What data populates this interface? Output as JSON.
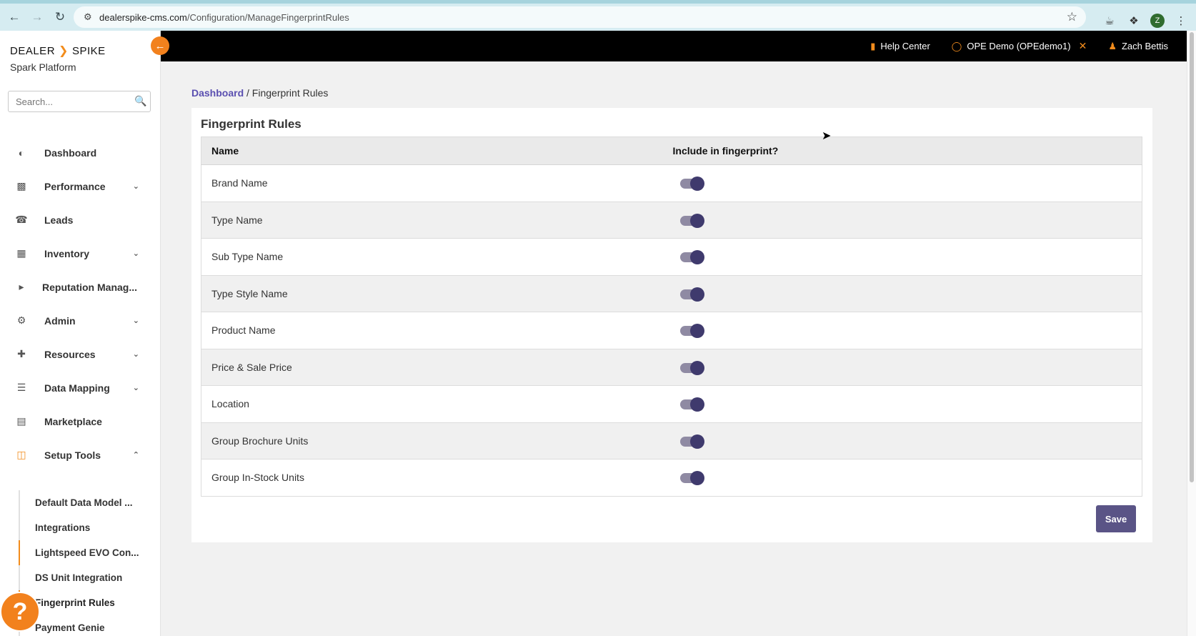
{
  "browser": {
    "url_host": "dealerspike-cms.com",
    "url_path": "/Configuration/ManageFingerprintRules",
    "profile_initial": "Z"
  },
  "sidebar": {
    "logo_left": "DEALER",
    "logo_right": "SPIKE",
    "logo_sub": "Spark Platform",
    "search_placeholder": "Search...",
    "items": [
      {
        "label": "Dashboard",
        "icon": "gauge-icon",
        "has_chevron": false
      },
      {
        "label": "Performance",
        "icon": "chart-icon",
        "has_chevron": true
      },
      {
        "label": "Leads",
        "icon": "phone-icon",
        "has_chevron": false
      },
      {
        "label": "Inventory",
        "icon": "cubes-icon",
        "has_chevron": true
      },
      {
        "label": "Reputation Manag...",
        "icon": "megaphone-icon",
        "has_chevron": false
      },
      {
        "label": "Admin",
        "icon": "cogs-icon",
        "has_chevron": true
      },
      {
        "label": "Resources",
        "icon": "wrench-icon",
        "has_chevron": true
      },
      {
        "label": "Data Mapping",
        "icon": "database-icon",
        "has_chevron": true
      },
      {
        "label": "Marketplace",
        "icon": "basket-icon",
        "has_chevron": false
      },
      {
        "label": "Setup Tools",
        "icon": "columns-icon",
        "has_chevron": true
      }
    ],
    "sub_items": [
      {
        "label": "Default Data Model ..."
      },
      {
        "label": "Integrations"
      },
      {
        "label": "Lightspeed EVO Con..."
      },
      {
        "label": "DS Unit Integration"
      },
      {
        "label": "Fingerprint Rules"
      },
      {
        "label": "Payment Genie"
      }
    ]
  },
  "topbar": {
    "help_center": "Help Center",
    "account": "OPE Demo (OPEdemo1)",
    "user": "Zach Bettis"
  },
  "breadcrumb": {
    "root": "Dashboard",
    "separator": " / ",
    "current": "Fingerprint Rules"
  },
  "card": {
    "title": "Fingerprint Rules",
    "columns": {
      "name": "Name",
      "include": "Include in fingerprint?"
    },
    "rules": [
      {
        "name": "Brand Name",
        "included": true
      },
      {
        "name": "Type Name",
        "included": true
      },
      {
        "name": "Sub Type Name",
        "included": true
      },
      {
        "name": "Type Style Name",
        "included": true
      },
      {
        "name": "Product Name",
        "included": true
      },
      {
        "name": "Price & Sale Price",
        "included": true
      },
      {
        "name": "Location",
        "included": true
      },
      {
        "name": "Group Brochure Units",
        "included": true
      },
      {
        "name": "Group In-Stock Units",
        "included": true
      }
    ],
    "save_label": "Save"
  },
  "colors": {
    "accent_orange": "#f28c1c",
    "toggle_knob": "#3f3a6d",
    "save_button": "#5a5486",
    "breadcrumb_link": "#5a4fb0"
  }
}
